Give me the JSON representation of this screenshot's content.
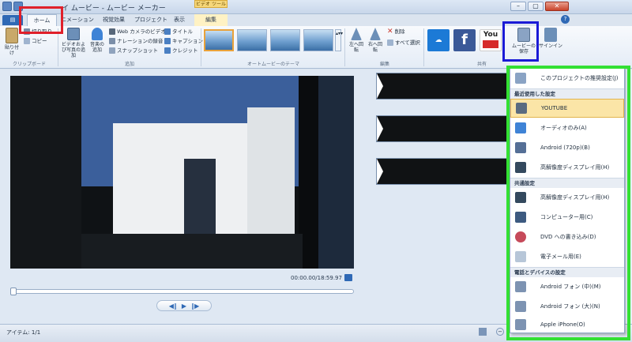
{
  "window": {
    "title": "イ ムービー - ムービー メーカー",
    "context_group": "ビデオ ツール"
  },
  "tabs": [
    {
      "label": "ホーム"
    },
    {
      "label": "ニメーション"
    },
    {
      "label": "視覚効果"
    },
    {
      "label": "プロジェクト"
    },
    {
      "label": "表示"
    },
    {
      "label": "編集"
    }
  ],
  "ribbon": {
    "clipboard": {
      "paste_label": "貼り付け",
      "cut_label": "切り取り",
      "copy_label": "コピー",
      "group_label": "クリップボード"
    },
    "add": {
      "add_videos_label": "ビデオおよび写真の追加",
      "add_music_label": "音楽の追加",
      "webcam_label": "Web カメラのビデオ",
      "narration_label": "ナレーションの録音",
      "snapshot_label": "スナップショット",
      "title_label": "タイトル",
      "caption_label": "キャプション",
      "credits_label": "クレジット",
      "group_label": "追加"
    },
    "themes": {
      "group_label": "オートムービーのテーマ"
    },
    "editing": {
      "rotate_left_label": "左へ回転",
      "rotate_right_label": "右へ回転",
      "remove_label": "削除",
      "select_all_label": "すべて選択",
      "group_label": "編集"
    },
    "share": {
      "onedrive_icon": "cloud-icon",
      "facebook_text": "f",
      "youtube_text": "You",
      "save_movie_label": "ムービーの保存",
      "signin_label": "サインイン",
      "group_label": "共有"
    }
  },
  "preview": {
    "time": "00:00.00/18:59.97"
  },
  "status": {
    "items_label": "アイテム: 1/1"
  },
  "menu": {
    "recommended": "このプロジェクトの推奨設定(J)",
    "recent_header": "最近使用した設定",
    "recent": [
      {
        "label": "YOUTUBE",
        "icon": "youtube-icon"
      },
      {
        "label": "オーディオのみ(A)",
        "icon": "music-note-icon"
      },
      {
        "label": "Android (720p)(B)",
        "icon": "android-icon"
      },
      {
        "label": "高解像度ディスプレイ用(H)",
        "icon": "film-icon"
      }
    ],
    "common_header": "共通設定",
    "common": [
      {
        "label": "高解像度ディスプレイ用(H)",
        "icon": "film-icon"
      },
      {
        "label": "コンピューター用(C)",
        "icon": "computer-icon"
      },
      {
        "label": "DVD への書き込み(D)",
        "icon": "dvd-icon"
      },
      {
        "label": "電子メール用(E)",
        "icon": "email-icon"
      }
    ],
    "device_header": "電話とデバイスの設定",
    "devices": [
      {
        "label": "Android フォン (中)(M)",
        "icon": "phone-icon"
      },
      {
        "label": "Android フォン (大)(N)",
        "icon": "phone-icon"
      },
      {
        "label": "Apple iPhone(O)",
        "icon": "phone-icon"
      }
    ]
  },
  "highlights": {
    "red": "#e0202a",
    "blue": "#1a1ad6",
    "green": "#33e033"
  }
}
